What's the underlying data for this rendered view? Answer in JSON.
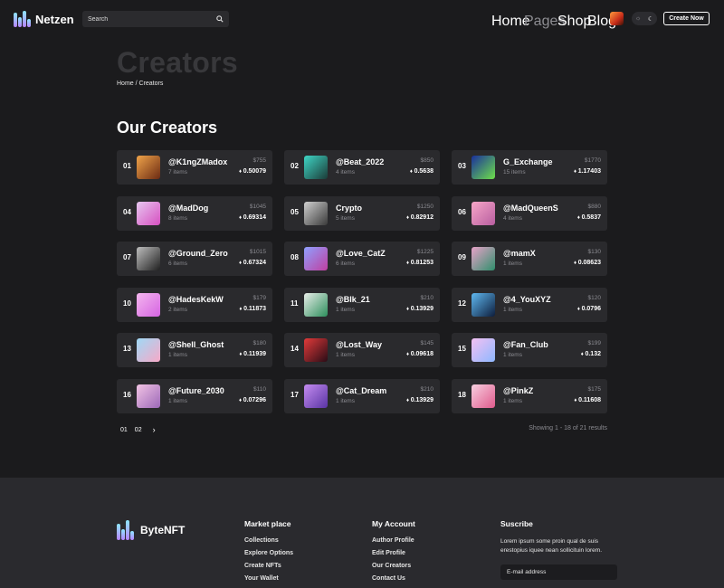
{
  "header": {
    "brand": "Netzen",
    "search_placeholder": "Search",
    "nav": [
      {
        "label": "Home",
        "active": true
      },
      {
        "label": "Pages",
        "active": false
      },
      {
        "label": "Shop",
        "active": true
      },
      {
        "label": "Blog",
        "active": true
      }
    ],
    "theme_icons": [
      "sun-icon",
      "moon-icon"
    ],
    "create_label": "Create Now"
  },
  "hero": {
    "title": "Creators",
    "breadcrumb": "Home / Creators"
  },
  "section_title": "Our Creators",
  "creators": [
    {
      "rank": "01",
      "name": "@K1ngZMadox",
      "items": "7 items",
      "price": "$755",
      "eth": "0.50079",
      "colors": [
        "#f0a44a",
        "#6b2a12"
      ]
    },
    {
      "rank": "02",
      "name": "@Beat_2022",
      "items": "4 items",
      "price": "$850",
      "eth": "0.5638",
      "colors": [
        "#3fd6c6",
        "#1b3b37"
      ]
    },
    {
      "rank": "03",
      "name": "G_Exchange",
      "items": "15 items",
      "price": "$1770",
      "eth": "1.17403",
      "colors": [
        "#1a2f9c",
        "#6ee04a"
      ]
    },
    {
      "rank": "04",
      "name": "@MadDog",
      "items": "8 items",
      "price": "$1045",
      "eth": "0.69314",
      "colors": [
        "#e7c7f0",
        "#d64fc0"
      ]
    },
    {
      "rank": "05",
      "name": "Crypto",
      "items": "5 items",
      "price": "$1250",
      "eth": "0.82912",
      "colors": [
        "#cfcfcf",
        "#3a3a3a"
      ]
    },
    {
      "rank": "06",
      "name": "@MadQueenS",
      "items": "4 items",
      "price": "$880",
      "eth": "0.5837",
      "colors": [
        "#f7a6c8",
        "#b85ea0"
      ]
    },
    {
      "rank": "07",
      "name": "@Ground_Zero",
      "items": "6 items",
      "price": "$1015",
      "eth": "0.67324",
      "colors": [
        "#bdbdbd",
        "#202020"
      ]
    },
    {
      "rank": "08",
      "name": "@Love_CatZ",
      "items": "6 items",
      "price": "$1225",
      "eth": "0.81253",
      "colors": [
        "#8fa0ff",
        "#c03fa0"
      ]
    },
    {
      "rank": "09",
      "name": "@mamX",
      "items": "1 items",
      "price": "$130",
      "eth": "0.08623",
      "colors": [
        "#e8a2c8",
        "#2f8f6c"
      ]
    },
    {
      "rank": "10",
      "name": "@HadesKekW",
      "items": "2 items",
      "price": "$179",
      "eth": "0.11873",
      "colors": [
        "#f4b6ee",
        "#d564e2"
      ]
    },
    {
      "rank": "11",
      "name": "@Blk_21",
      "items": "1 items",
      "price": "$210",
      "eth": "0.13929",
      "colors": [
        "#e9eee9",
        "#2d8f5c"
      ]
    },
    {
      "rank": "12",
      "name": "@4_YouXYZ",
      "items": "1 items",
      "price": "$120",
      "eth": "0.0796",
      "colors": [
        "#5fb8f0",
        "#0d1d3c"
      ]
    },
    {
      "rank": "13",
      "name": "@Shell_Ghost",
      "items": "1 items",
      "price": "$180",
      "eth": "0.11939",
      "colors": [
        "#9fd9f6",
        "#f7a9c7"
      ]
    },
    {
      "rank": "14",
      "name": "@Lost_Way",
      "items": "1 items",
      "price": "$145",
      "eth": "0.09618",
      "colors": [
        "#e23a3a",
        "#2a0c16"
      ]
    },
    {
      "rank": "15",
      "name": "@Fan_Club",
      "items": "1 items",
      "price": "$199",
      "eth": "0.132",
      "colors": [
        "#f4c0f2",
        "#8eb8ff"
      ]
    },
    {
      "rank": "16",
      "name": "@Future_2030",
      "items": "1 items",
      "price": "$110",
      "eth": "0.07296",
      "colors": [
        "#f2c4e4",
        "#9c68b8"
      ]
    },
    {
      "rank": "17",
      "name": "@Cat_Dream",
      "items": "1 items",
      "price": "$210",
      "eth": "0.13929",
      "colors": [
        "#c48cf0",
        "#5a34a4"
      ]
    },
    {
      "rank": "18",
      "name": "@PinkZ",
      "items": "1 items",
      "price": "$175",
      "eth": "0.11608",
      "colors": [
        "#f7cfe0",
        "#e05a8c"
      ]
    }
  ],
  "pagination": {
    "pages": [
      "01",
      "02"
    ],
    "next": "›",
    "showing": "Showing 1 - 18 of 21 results"
  },
  "footer": {
    "brand": "ByteNFT",
    "marketplace": {
      "title": "Market place",
      "links": [
        "Collections",
        "Explore Options",
        "Create NFTs",
        "Your Wallet"
      ]
    },
    "account": {
      "title": "My Account",
      "links": [
        "Author Profile",
        "Edit Profile",
        "Our Creators",
        "Contact Us"
      ]
    },
    "subscribe": {
      "title": "Suscribe",
      "text": "Lorem ipsum some proin qual de suis erestopius iquee nean sollicituin lorem.",
      "email_placeholder": "E-mail address"
    }
  }
}
